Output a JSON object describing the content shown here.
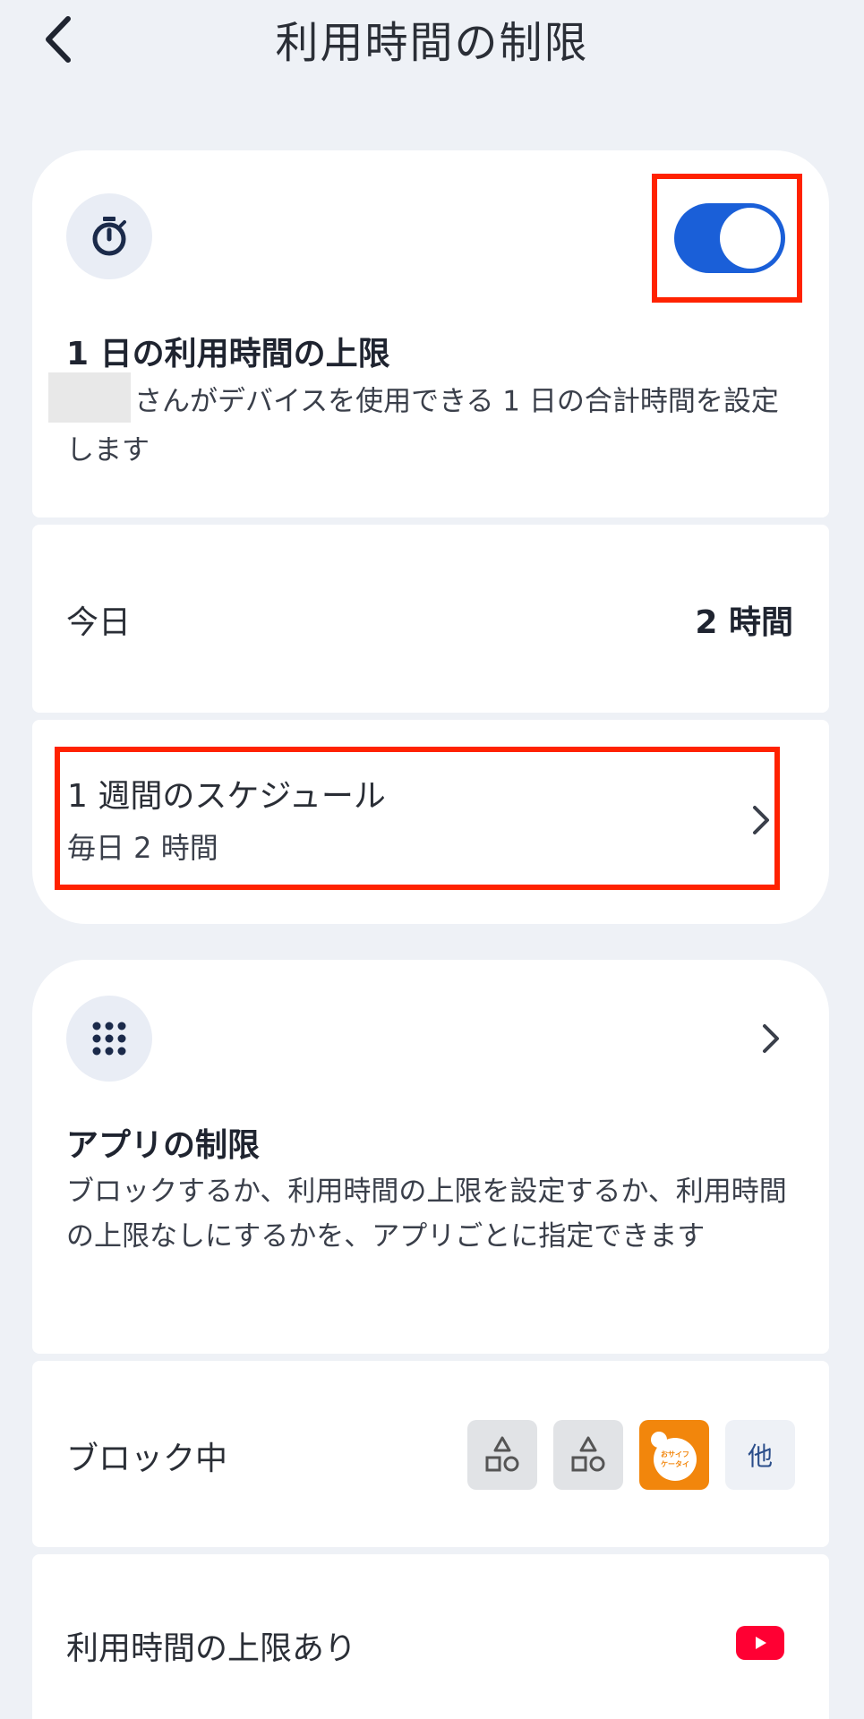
{
  "header": {
    "title": "利用時間の制限",
    "back_icon": "chevron-left-icon"
  },
  "daily_limit": {
    "icon": "stopwatch-icon",
    "toggle_on": true,
    "title": "1 日の利用時間の上限",
    "description": "さんがデバイスを使用できる 1 日の合計時間を設定します",
    "accent_color": "#1a5fd8"
  },
  "today": {
    "label": "今日",
    "value": "2 時間"
  },
  "weekly_schedule": {
    "title": "1 週間のスケジュール",
    "subtitle": "毎日 2 時間"
  },
  "app_limits": {
    "icon": "apps-grid-icon",
    "title": "アプリの制限",
    "description": "ブロックするか、利用時間の上限を設定するか、利用時間の上限なしにするかを、アプリごとに指定できます"
  },
  "blocked": {
    "label": "ブロック中",
    "apps": [
      "generic-app-icon",
      "generic-app-icon",
      "osaifu-keitai-icon"
    ],
    "osaifu_text": "おサイフケータイ",
    "more_label": "他"
  },
  "time_limited": {
    "label": "利用時間の上限あり",
    "app_icon": "youtube-icon"
  }
}
